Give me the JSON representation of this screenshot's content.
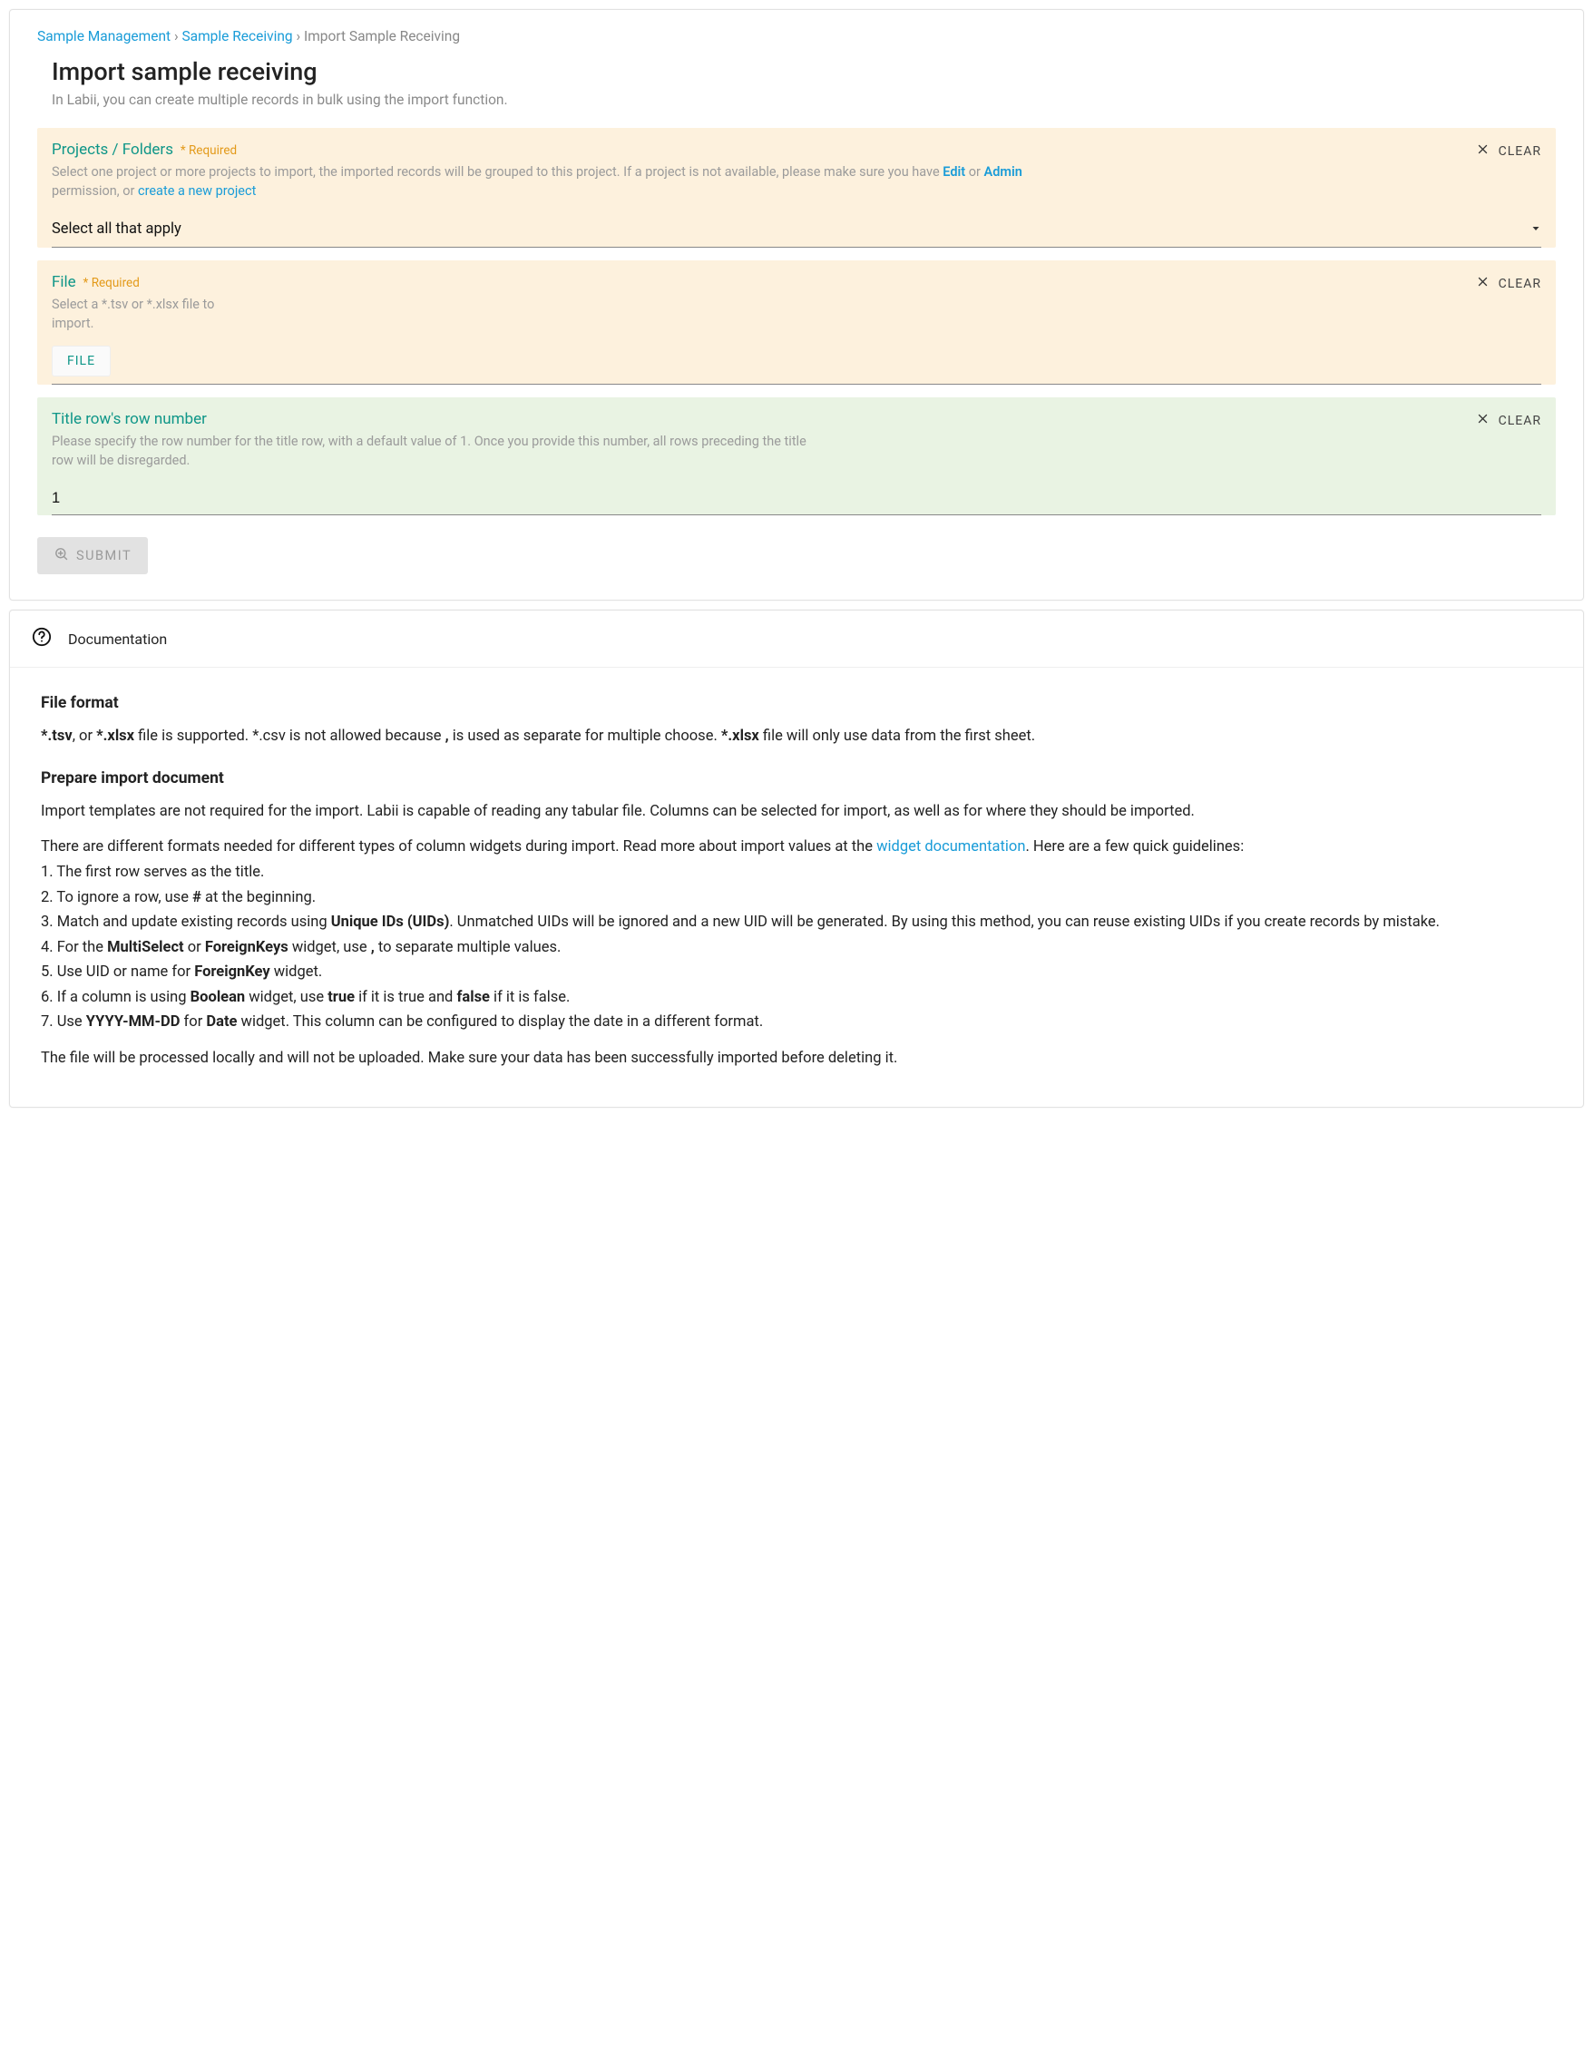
{
  "breadcrumb": {
    "items": [
      "Sample Management",
      "Sample Receiving"
    ],
    "current": "Import Sample Receiving"
  },
  "page": {
    "title": "Import sample receiving",
    "description": "In Labii, you can create multiple records in bulk using the import function."
  },
  "clear_label": "CLEAR",
  "fields": {
    "projects": {
      "label": "Projects / Folders",
      "required": "* Required",
      "help_pre": "Select one project or more projects to import, the imported records will be grouped to this project. If a project is not available, please make sure you have ",
      "edit": "Edit",
      "or_word": " or ",
      "admin": "Admin",
      "permission_word": " permission",
      "help_post": ", or ",
      "create_link": "create a new project",
      "placeholder": "Select all that apply"
    },
    "file": {
      "label": "File",
      "required": "* Required",
      "help": "Select a *.tsv or *.xlsx file to import.",
      "button": "FILE"
    },
    "titlerow": {
      "label": "Title row's row number",
      "help": "Please specify the row number for the title row, with a default value of 1. Once you provide this number, all rows preceding the title row will be disregarded.",
      "value": "1"
    }
  },
  "submit_label": "SUBMIT",
  "documentation": {
    "header": "Documentation",
    "h_fileformat": "File format",
    "fileformat_p": {
      "tsv": "*.tsv",
      "or": ", or ",
      "xlsx": "*.xlsx",
      "mid1": " file is supported. *.csv is not allowed because ",
      "comma": ",",
      "mid2": " is used as separate for multiple choose. ",
      "xlsx2": "*.xlsx",
      "end": " file will only use data from the first sheet."
    },
    "h_prepare": "Prepare import document",
    "prepare_p1": "Import templates are not required for the import. Labii is capable of reading any tabular file. Columns can be selected for import, as well as for where they should be imported.",
    "prepare_p2_pre": "There are different formats needed for different types of column widgets during import. Read more about import values at the ",
    "prepare_link": "widget documentation",
    "prepare_p2_post": ". Here are a few quick guidelines:",
    "list": {
      "i1": "1. The first row serves as the title.",
      "i2a": "2. To ignore a row, use ",
      "i2b": "#",
      "i2c": " at the beginning.",
      "i3a": "3. Match and update existing records using ",
      "i3b": "Unique IDs (UIDs)",
      "i3c": ". Unmatched UIDs will be ignored and a new UID will be generated. By using this method, you can reuse existing UIDs if you create records by mistake.",
      "i4a": "4. For the ",
      "i4b": "MultiSelect",
      "i4c": " or ",
      "i4d": "ForeignKeys",
      "i4e": " widget, use ",
      "i4f": ",",
      "i4g": " to separate multiple values.",
      "i5a": "5. Use UID or name for ",
      "i5b": "ForeignKey",
      "i5c": " widget.",
      "i6a": "6. If a column is using ",
      "i6b": "Boolean",
      "i6c": " widget, use ",
      "i6d": "true",
      "i6e": " if it is true and ",
      "i6f": "false",
      "i6g": " if it is false.",
      "i7a": "7. Use ",
      "i7b": "YYYY-MM-DD",
      "i7c": " for ",
      "i7d": "Date",
      "i7e": " widget. This column can be configured to display the date in a different format."
    },
    "footer_p": "The file will be processed locally and will not be uploaded. Make sure your data has been successfully imported before deleting it."
  }
}
